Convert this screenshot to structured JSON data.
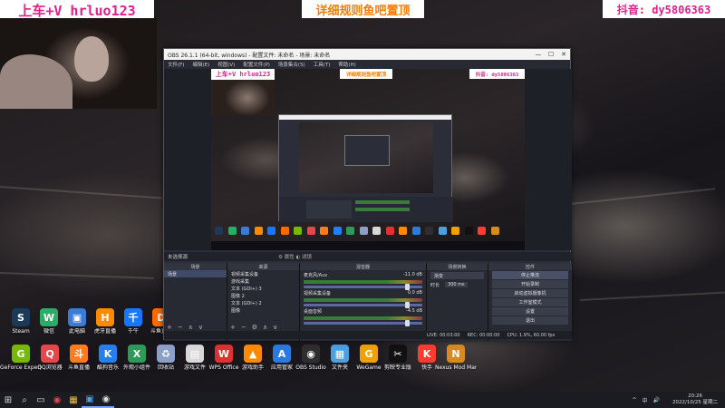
{
  "overlays": {
    "left": "上车+V hrluo123",
    "center": "详细规则鱼吧置顶",
    "right": "抖音: dy5806363"
  },
  "desktop_icons": [
    {
      "name": "steam",
      "label": "Steam",
      "color": "#1b3a5a",
      "glyph": "S"
    },
    {
      "name": "wechat",
      "label": "微信",
      "color": "#2aae67",
      "glyph": "W"
    },
    {
      "name": "computer",
      "label": "此电脑",
      "color": "#3a7bd5",
      "glyph": "▣"
    },
    {
      "name": "huya",
      "label": "虎牙直播",
      "color": "#ff8a00",
      "glyph": "H"
    },
    {
      "name": "qianniu",
      "label": "千牛",
      "color": "#1677ff",
      "glyph": "千"
    },
    {
      "name": "douyu",
      "label": "斗鱼直播",
      "color": "#ff6a00",
      "glyph": "D"
    },
    {
      "name": "geforce",
      "label": "GeForce Experience",
      "color": "#76b900",
      "glyph": "G"
    },
    {
      "name": "qq-browser",
      "label": "QQ浏览器",
      "color": "#e8464a",
      "glyph": "Q"
    },
    {
      "name": "douyu-live",
      "label": "斗鱼直播",
      "color": "#ff7b1c",
      "glyph": "斗"
    },
    {
      "name": "kugou",
      "label": "酷狗音乐",
      "color": "#2480f0",
      "glyph": "K"
    },
    {
      "name": "excel",
      "label": "外观小组件",
      "color": "#2e9a5a",
      "glyph": "X"
    },
    {
      "name": "recycle",
      "label": "回收站",
      "color": "#8aa0c8",
      "glyph": "♻"
    },
    {
      "name": "file",
      "label": "游戏文件",
      "color": "#d8d8d8",
      "glyph": "▤"
    },
    {
      "name": "wps",
      "label": "WPS Office",
      "color": "#e03030",
      "glyph": "W"
    },
    {
      "name": "game-helper",
      "label": "游戏助手",
      "color": "#ff8a00",
      "glyph": "▲"
    },
    {
      "name": "app-manager",
      "label": "应用管家",
      "color": "#2a7ae2",
      "glyph": "A"
    },
    {
      "name": "obs",
      "label": "OBS Studio",
      "color": "#2e2e2e",
      "glyph": "◉"
    },
    {
      "name": "folder",
      "label": "文件夹",
      "color": "#4aa0e0",
      "glyph": "▦"
    },
    {
      "name": "wegame",
      "label": "WeGame",
      "color": "#f0a000",
      "glyph": "G"
    },
    {
      "name": "capcut",
      "label": "剪映专业版",
      "color": "#111111",
      "glyph": "✂"
    },
    {
      "name": "kuaishou",
      "label": "快手",
      "color": "#ff3b30",
      "glyph": "K"
    },
    {
      "name": "nexus",
      "label": "Nexus Mod Manager",
      "color": "#d88a20",
      "glyph": "N"
    }
  ],
  "obs": {
    "title": "OBS 26.1.1 (64-bit, windows) - 配置文件: 未命名 - 场景: 未命名",
    "menu": [
      "文件(F)",
      "编辑(E)",
      "视图(V)",
      "配置文件(P)",
      "场景集合(S)",
      "工具(T)",
      "帮助(H)"
    ],
    "win_min": "—",
    "win_max": "☐",
    "win_close": "✕",
    "scene_bar": "未选择源",
    "scene_bar_tabs": "⚙ 属性  ◐ 滤镜",
    "docks": {
      "scenes": {
        "title": "场景",
        "items": [
          "场景"
        ]
      },
      "sources": {
        "title": "来源",
        "items": [
          "視频采集设备",
          "游戏采集",
          "文本 (GDI+) 3",
          "图像 2",
          "文本 (GDI+) 2",
          "图像"
        ]
      },
      "mixer": {
        "title": "混音器",
        "channels": [
          {
            "name": "麦克风/Aux",
            "db": "-11.0 dB"
          },
          {
            "name": "视频采集设备",
            "db": "0.0 dB"
          },
          {
            "name": "桌面音频",
            "db": "-4.5 dB"
          }
        ]
      },
      "transitions": {
        "title": "场景转换",
        "type": "渐变",
        "duration_label": "时长",
        "duration": "300 ms"
      },
      "controls": {
        "title": "控件",
        "buttons": [
          "停止推流",
          "开始录制",
          "启动虚拟摄像机",
          "工作室模式",
          "设置",
          "退出"
        ]
      }
    },
    "status": {
      "live": "LIVE: 00:03:00",
      "rec": "REC: 00:00:00",
      "cpu": "CPU: 1.9%, 60.00 fps"
    }
  },
  "taskbar": {
    "time": "20:26",
    "date": "2022/10/25 星期二",
    "tray_items": [
      "^",
      "中",
      "🔊"
    ]
  }
}
